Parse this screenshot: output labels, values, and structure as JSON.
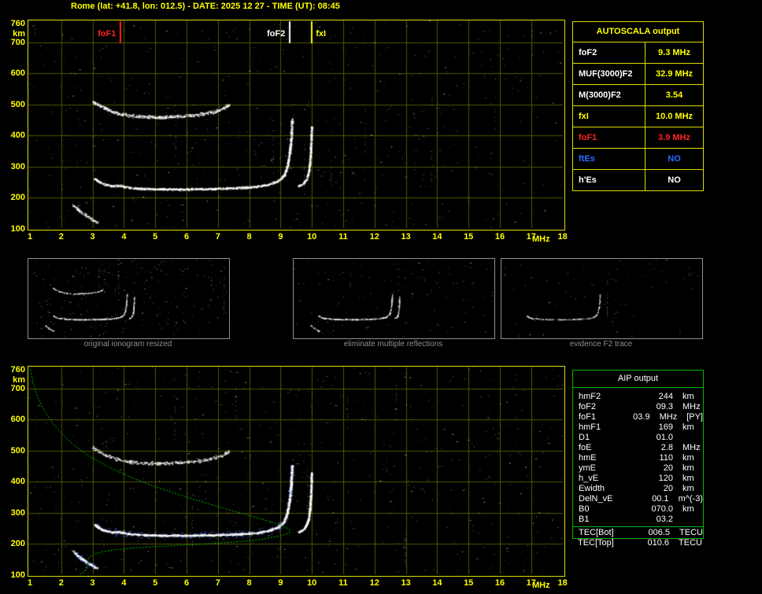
{
  "title": "Rome (lat: +41.8, lon: 012.5) - DATE: 2025 12 27 - TIME (UT): 08:45",
  "colors": {
    "yellow": "#ffff00",
    "red": "#ff2222",
    "blue": "#2a6bff",
    "green": "#00c800",
    "white": "#ffffff",
    "grid": "#565600",
    "border_yellow": "#dcdc00",
    "border_green": "#00b400",
    "caption_gray": "#8f8f8f"
  },
  "autoscala_table": {
    "header": "AUTOSCALA output",
    "rows": [
      {
        "label": "foF2",
        "value": "9.3 MHz",
        "label_color": "#ffffff",
        "value_color": "#ffff00"
      },
      {
        "label": "MUF(3000)F2",
        "value": "32.9 MHz",
        "label_color": "#ffffff",
        "value_color": "#ffff00"
      },
      {
        "label": "M(3000)F2",
        "value": "3.54",
        "label_color": "#ffffff",
        "value_color": "#ffff00"
      },
      {
        "label": "fxI",
        "value": "10.0 MHz",
        "label_color": "#ffff00",
        "value_color": "#ffff00"
      },
      {
        "label": "foF1",
        "value": "3.9 MHz",
        "label_color": "#ff2222",
        "value_color": "#ff2222"
      },
      {
        "label": "ftEs",
        "value": "NO",
        "label_color": "#2a6bff",
        "value_color": "#2a6bff"
      },
      {
        "label": "h'Es",
        "value": "NO",
        "label_color": "#ffffff",
        "value_color": "#ffffff"
      }
    ]
  },
  "aip_table": {
    "header": "AIP output",
    "rows": [
      {
        "name": "hmF2",
        "value": "244",
        "unit": "km",
        "extra": ""
      },
      {
        "name": "foF2",
        "value": "09.3",
        "unit": "MHz",
        "extra": ""
      },
      {
        "name": "foF1",
        "value": "03.9",
        "unit": "MHz",
        "extra": "[PY]"
      },
      {
        "name": "hmF1",
        "value": "169",
        "unit": "km",
        "extra": ""
      },
      {
        "name": "D1",
        "value": "01.0",
        "unit": "",
        "extra": ""
      },
      {
        "name": "foE",
        "value": "2.8",
        "unit": "MHz",
        "extra": ""
      },
      {
        "name": "hmE",
        "value": "110",
        "unit": "km",
        "extra": ""
      },
      {
        "name": "ymE",
        "value": "20",
        "unit": "km",
        "extra": ""
      },
      {
        "name": "h_vE",
        "value": "120",
        "unit": "km",
        "extra": ""
      },
      {
        "name": "Ewidth",
        "value": "20",
        "unit": "km",
        "extra": ""
      },
      {
        "name": "DelN_vE",
        "value": "00.1",
        "unit": "m^(-3)",
        "extra": ""
      },
      {
        "name": "B0",
        "value": "070.0",
        "unit": "km",
        "extra": ""
      },
      {
        "name": "B1",
        "value": "03.2",
        "unit": "",
        "extra": ""
      }
    ],
    "tec_bot": {
      "name": "TEC[Bot]",
      "value": "006.5",
      "unit": "TECU"
    },
    "tec_top": {
      "name": "TEC[Top]",
      "value": "010.6",
      "unit": "TECU"
    }
  },
  "thumbnails": [
    {
      "caption": "original ionogram resized"
    },
    {
      "caption": "eliminate multiple reflections"
    },
    {
      "caption": "evidence F2 trace"
    }
  ],
  "plot_markers": [
    {
      "label": "foF1",
      "freq": 3.9,
      "color": "#ff2222",
      "side": "left"
    },
    {
      "label": "foF2",
      "freq": 9.3,
      "color": "#ffffff",
      "side": "left"
    },
    {
      "label": "fxI",
      "freq": 10.0,
      "color": "#ffff00",
      "side": "right"
    }
  ],
  "chart_data": {
    "type": "scatter",
    "title": "Ionogram, Rome 2025-12-27 08:45 UT",
    "x_axis": {
      "label": "MHz",
      "min": 1,
      "max": 18,
      "ticks": [
        1,
        2,
        3,
        4,
        5,
        6,
        7,
        8,
        9,
        10,
        11,
        12,
        13,
        14,
        15,
        16,
        17,
        18
      ]
    },
    "y_axis": {
      "label": "km",
      "min": 100,
      "max": 760,
      "ticks": [
        760,
        700,
        600,
        500,
        400,
        300,
        200,
        100
      ]
    },
    "key_values": {
      "foF2_MHz": 9.3,
      "MUF3000F2_MHz": 32.9,
      "M3000F2": 3.54,
      "fxI_MHz": 10.0,
      "foF1_MHz": 3.9,
      "ftEs": "NO",
      "hEs": "NO",
      "hmF2_km": 244,
      "hmF1_km": 169,
      "foE_MHz": 2.8,
      "hmE_km": 110
    },
    "traces": {
      "E_layer": [
        [
          2.35,
          178
        ],
        [
          2.55,
          160
        ],
        [
          2.75,
          146
        ],
        [
          2.95,
          132
        ],
        [
          3.15,
          122
        ]
      ],
      "F_trace_o_mode": [
        [
          3.05,
          262
        ],
        [
          3.3,
          246
        ],
        [
          3.6,
          238
        ],
        [
          3.85,
          240
        ],
        [
          4.05,
          234
        ],
        [
          4.5,
          230
        ],
        [
          5.2,
          228
        ],
        [
          6.0,
          228
        ],
        [
          6.8,
          229
        ],
        [
          7.6,
          232
        ],
        [
          8.2,
          236
        ],
        [
          8.6,
          243
        ],
        [
          8.9,
          254
        ],
        [
          9.1,
          272
        ],
        [
          9.2,
          300
        ],
        [
          9.28,
          345
        ],
        [
          9.33,
          400
        ],
        [
          9.36,
          455
        ]
      ],
      "F_trace_x_mode": [
        [
          9.55,
          238
        ],
        [
          9.7,
          245
        ],
        [
          9.8,
          258
        ],
        [
          9.88,
          280
        ],
        [
          9.93,
          320
        ],
        [
          9.96,
          370
        ],
        [
          9.98,
          430
        ]
      ],
      "second_reflection": [
        [
          3.0,
          510
        ],
        [
          3.3,
          492
        ],
        [
          3.6,
          478
        ],
        [
          3.95,
          468
        ],
        [
          4.4,
          462
        ],
        [
          5.0,
          459
        ],
        [
          5.6,
          461
        ],
        [
          6.2,
          465
        ],
        [
          6.7,
          473
        ],
        [
          7.1,
          484
        ],
        [
          7.35,
          500
        ]
      ],
      "electron_density_profile": [
        [
          1.02,
          760
        ],
        [
          1.1,
          718
        ],
        [
          1.25,
          672
        ],
        [
          1.45,
          630
        ],
        [
          1.7,
          592
        ],
        [
          2.0,
          556
        ],
        [
          2.4,
          518
        ],
        [
          2.9,
          482
        ],
        [
          3.5,
          448
        ],
        [
          4.2,
          415
        ],
        [
          5.0,
          384
        ],
        [
          5.9,
          354
        ],
        [
          6.8,
          326
        ],
        [
          7.7,
          300
        ],
        [
          8.5,
          277
        ],
        [
          9.05,
          259
        ],
        [
          9.3,
          246
        ],
        [
          9.28,
          236
        ],
        [
          9.0,
          226
        ],
        [
          8.4,
          215
        ],
        [
          7.5,
          206
        ],
        [
          6.4,
          199
        ],
        [
          5.3,
          193
        ],
        [
          4.4,
          188
        ],
        [
          3.8,
          182
        ],
        [
          3.35,
          176
        ],
        [
          3.05,
          168
        ],
        [
          2.9,
          158
        ],
        [
          2.83,
          146
        ],
        [
          2.8,
          128
        ],
        [
          2.76,
          112
        ],
        [
          2.6,
          103
        ],
        [
          2.3,
          97
        ],
        [
          1.9,
          92
        ]
      ]
    }
  }
}
